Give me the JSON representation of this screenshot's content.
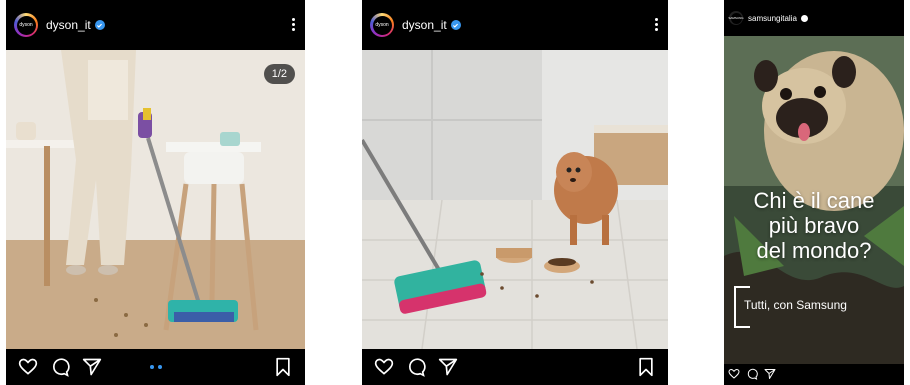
{
  "posts": [
    {
      "username": "dyson_it",
      "avatar_label": "dyson",
      "verified": true,
      "counter": "1/2",
      "carousel": {
        "total": 2,
        "active": 1
      }
    },
    {
      "username": "dyson_it",
      "avatar_label": "dyson",
      "verified": true
    },
    {
      "username": "samsungitalia",
      "avatar_label": "SAMSUNG",
      "verified": true,
      "caption_lines": [
        "Chi è il cane",
        "più bravo",
        "del mondo?"
      ],
      "cta": "Tutti, con Samsung"
    }
  ],
  "icons": {
    "like": "heart-icon",
    "comment": "comment-icon",
    "share": "send-icon",
    "save": "bookmark-icon",
    "menu": "more-options-icon"
  },
  "colors": {
    "accent": "#3897f0",
    "bar": "#000000"
  }
}
